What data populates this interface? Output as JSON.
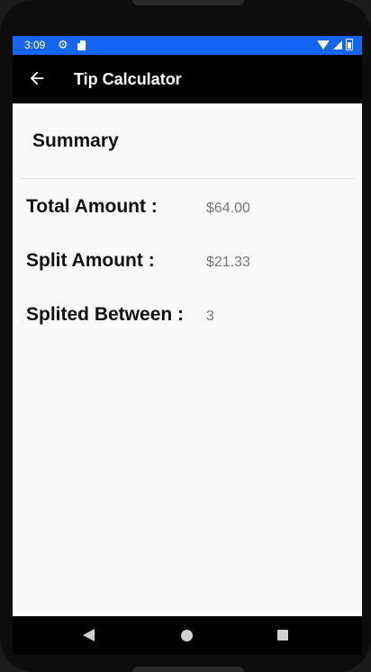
{
  "status_bar": {
    "time": "3:09",
    "gear_icon": "gear-icon",
    "sd_icon": "sd-card-icon"
  },
  "app_bar": {
    "title": "Tip Calculator",
    "back_icon": "back-arrow-icon"
  },
  "summary": {
    "heading": "Summary",
    "rows": [
      {
        "label": "Total Amount :",
        "value": "$64.00"
      },
      {
        "label": "Split Amount :",
        "value": "$21.33"
      },
      {
        "label": "Splited Between :",
        "value": "3"
      }
    ]
  },
  "colors": {
    "status_bar": "#1565f5",
    "app_bar": "#000000",
    "background": "#fafafa",
    "value_text": "#777777"
  }
}
